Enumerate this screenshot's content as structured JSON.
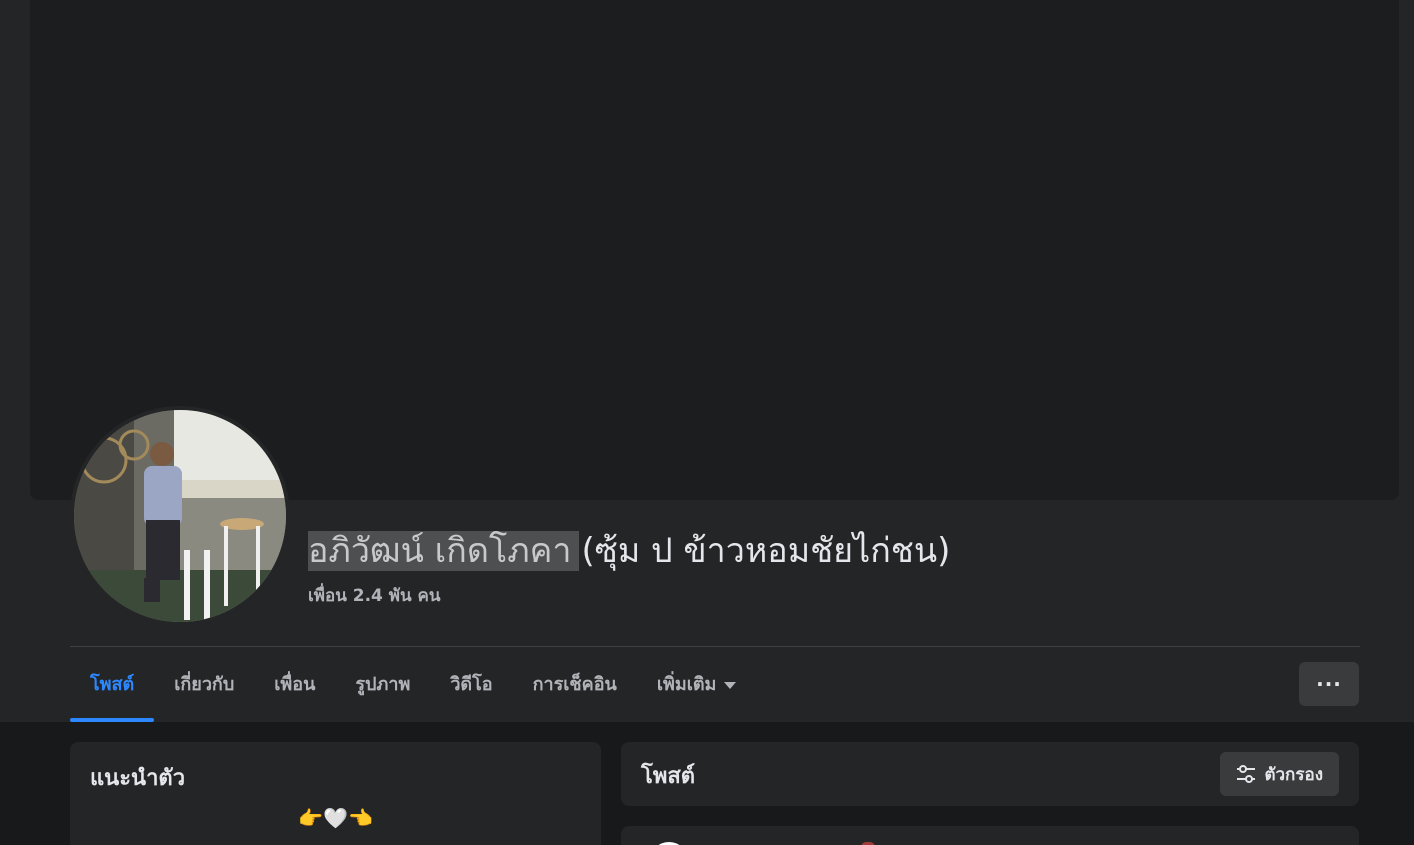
{
  "profile": {
    "name": "อภิวัฒน์ เกิดโภคา",
    "nickname": "(ซุ้ม ป ข้าวหอมชัยไก่ชน)",
    "friends_text": "เพื่อน 2.4 พัน คน"
  },
  "tabs": [
    {
      "label": "โพสต์",
      "active": true
    },
    {
      "label": "เกี่ยวกับ"
    },
    {
      "label": "เพื่อน"
    },
    {
      "label": "รูปภาพ"
    },
    {
      "label": "วิดีโอ"
    },
    {
      "label": "การเช็คอิน"
    },
    {
      "label": "เพิ่มเติม"
    }
  ],
  "more_button": "···",
  "intro": {
    "title": "แนะนำตัว",
    "bio": "👉🤍👈"
  },
  "posts": {
    "title": "โพสต์",
    "filter_label": "ตัวกรอง"
  },
  "colors": {
    "accent": "#2d88ff",
    "surface": "#242526",
    "background": "#18191a"
  }
}
